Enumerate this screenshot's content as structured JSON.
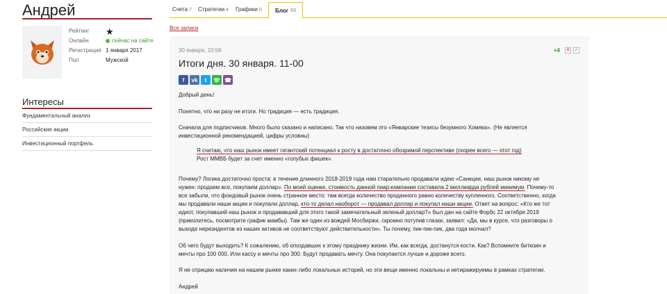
{
  "profile": {
    "name": "Андрей",
    "rows": [
      {
        "label": "Рейтинг",
        "value": ""
      },
      {
        "label": "Онлайн",
        "value": "сейчас на сайте"
      },
      {
        "label": "Регистрация",
        "value": "1 января 2017"
      },
      {
        "label": "Пол",
        "value": "Мужской"
      }
    ]
  },
  "interests": {
    "title": "Интересы",
    "items": [
      "Фундаментальный анализ",
      "Российские акции",
      "Инвестиционный портфель"
    ]
  },
  "tabs": [
    {
      "label": "Счета",
      "count": "7"
    },
    {
      "label": "Стратегии",
      "count": "4"
    },
    {
      "label": "Графики",
      "count": "0"
    },
    {
      "label": "Блог",
      "count": "63"
    }
  ],
  "all_posts": "Все записи",
  "post": {
    "date": "30 января, 10:56",
    "votes": "+4",
    "title": "Итоги дня. 30 января. 11-00",
    "share_icons": [
      "facebook-icon",
      "vk-icon",
      "twitter-icon",
      "whatsapp-icon",
      "viber-icon"
    ],
    "p1": "Добрый день!",
    "p2": "Понятно, что ни разу не итоги. Но традиция — есть традиция.",
    "p3_l1": "Сначала для подписчиков. Много было сказано и написано. Так что назовем это «Январские тезисы безумного Хомяка». (Не является",
    "p3_l2": "инвестиционной рекомендацией, цифры условны)",
    "quote_l1": "Я считаю, что наш рынок имеет гигантский потенциал к росту в достаточно обозримой перспективе (скорее всего — этот год)",
    "quote_l2": "Рост ММВБ будет за счет именно «голубых фишек».",
    "p4_l1": "Почему? Логика достаточно проста: в течение длинного 2018-2019 года нам старательно продавали идею «Санкции, наш рынок никому не",
    "p4_l2a": "нужен: продаем все, покупаем доллар».",
    "p4_l2b": "По моей оценке, стоимость данной пиар-компании составила 2 миллиарда рублей минимум.",
    "p4_l2c": "Почему-то",
    "p4_l3": "все забыли, что фондовый рынок очень странное место: там всегда количество проданного равно количеству купленного. Соответственно, когда",
    "p4_l4a": "мы продавали наши акции и покупали доллар,",
    "p4_l4b": "кто-то делал наоборот — продавал доллар и покупал наши акции.",
    "p4_l4c": "Ответ на вопрос: «Кто же тот",
    "p4_l5": "идиот, покупавший наш рынок и продававший для этого такой замечательный зеленый доллар?» был дан на сайте Форбс 22 октября 2019",
    "p4_l6": "(приколитесь, посмотрите график мамбы). Там же один из вождей Мосбиржи, скромно потупив глазки, заявил: «Да, мы в курсе, что разговоры о",
    "p4_l7": "выходе нерезидентов из наших активов не соответствуют действительности». Ты почему, пик-пик-пик, два года молчал?",
    "p5_l1": "Об чего будут выходить? К сожалению, об опоздавших к этому празднику жизни. Им, как всегда, достанутся кости. Как? Вспомните биткоин и",
    "p5_l2": "мечты про 100 000. Или кассу и мечты про 300. Будут продавать мечту. Она покупается лучше и дороже всего.",
    "p6": "Я не отрицаю наличия на нашем рынке каких-либо локальных историй, но эти вещи именно локальны и нетиражируемы в рамках стратегии.",
    "p7": "Андрей"
  }
}
